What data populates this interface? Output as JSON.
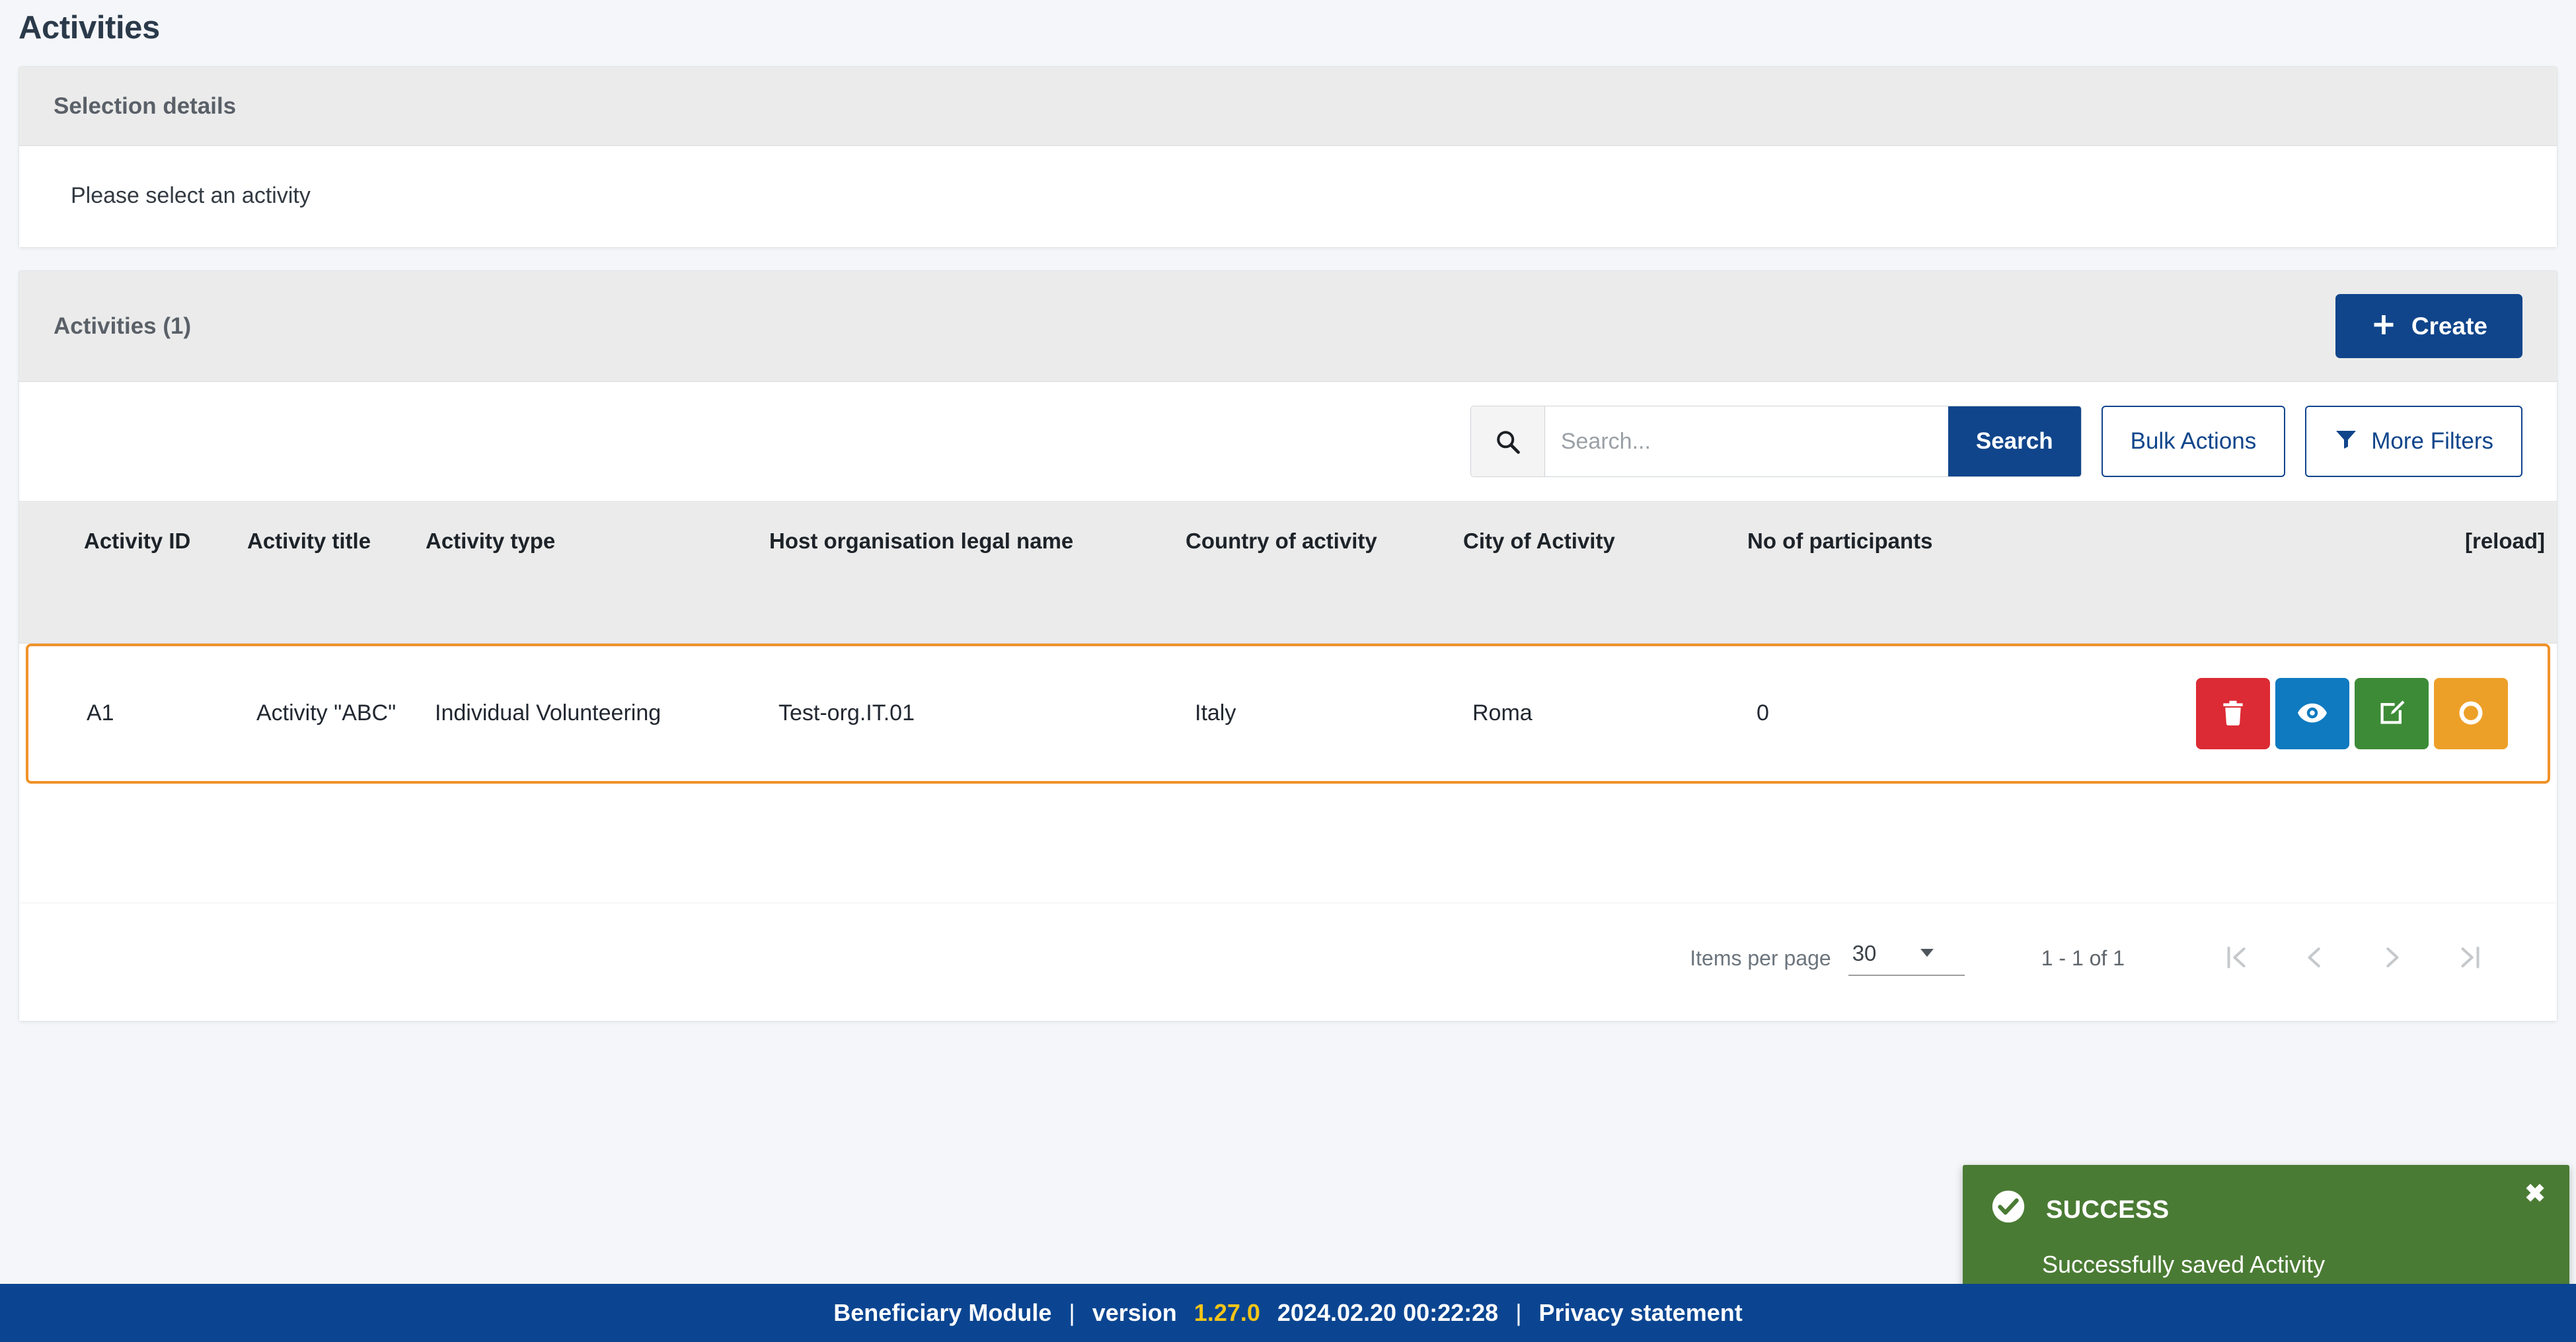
{
  "page": {
    "title": "Activities"
  },
  "selection_details": {
    "header": "Selection details",
    "message": "Please select an activity"
  },
  "activities": {
    "header": "Activities (1)",
    "create_label": "Create",
    "create_icon": "plus-icon"
  },
  "toolbar": {
    "search_icon": "search-icon",
    "search_value": "",
    "search_placeholder": "Search...",
    "search_label": "Search",
    "bulk_actions_label": "Bulk Actions",
    "more_filters_label": "More Filters",
    "filter_icon": "funnel-icon"
  },
  "table": {
    "columns": [
      "Activity ID",
      "Activity title",
      "Activity type",
      "Host organisation legal name",
      "Country of activity",
      "City of Activity",
      "No of participants"
    ],
    "reload_label": "[reload]",
    "rows": [
      {
        "activity_id": "A1",
        "activity_title": "Activity \"ABC\"",
        "activity_type": "Individual Volunteering",
        "host_organisation": "Test-org.IT.01",
        "country": "Italy",
        "city": "Roma",
        "participants": "0",
        "actions": [
          {
            "name": "delete-button",
            "icon": "trash-icon",
            "color": "#dc2b34"
          },
          {
            "name": "view-button",
            "icon": "eye-icon",
            "color": "#0f7ac0"
          },
          {
            "name": "edit-button",
            "icon": "pencil-square-icon",
            "color": "#3d8b37"
          },
          {
            "name": "status-button",
            "icon": "circle-icon",
            "color": "#eda028"
          }
        ]
      }
    ]
  },
  "paginator": {
    "items_per_page_label": "Items per page",
    "items_per_page_value": "30",
    "range_label": "1 - 1 of 1",
    "first_icon": "first-page-icon",
    "prev_icon": "previous-page-icon",
    "next_icon": "next-page-icon",
    "last_icon": "last-page-icon"
  },
  "toast": {
    "icon": "check-circle-icon",
    "title": "SUCCESS",
    "message": "Successfully saved Activity",
    "close_icon": "close-icon",
    "close_label": "✖",
    "color": "#4a7b34"
  },
  "footer": {
    "app_name": "Beneficiary Module",
    "separator1": "|",
    "version_label": "version",
    "version": "1.27.0",
    "timestamp": "2024.02.20 00:22:28",
    "separator2": "|",
    "privacy_label": "Privacy statement"
  },
  "colors": {
    "brand_blue": "#10458b",
    "footer_blue": "#0b4591",
    "row_highlight": "#f0922b",
    "success_green": "#4a7b34"
  }
}
